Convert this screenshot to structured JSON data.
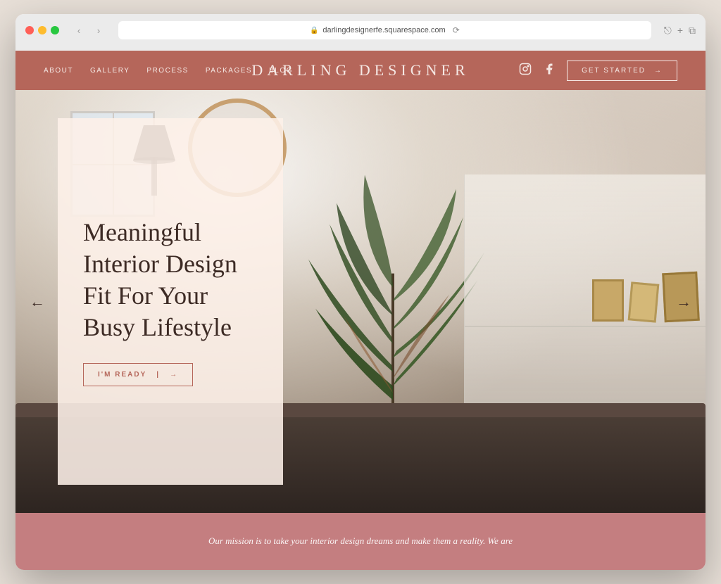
{
  "browser": {
    "url": "darlingdesignerfe.squarespace.com",
    "reload_label": "⟳"
  },
  "nav": {
    "links": [
      {
        "id": "about",
        "label": "About"
      },
      {
        "id": "gallery",
        "label": "Gallery"
      },
      {
        "id": "process",
        "label": "Process"
      },
      {
        "id": "packages",
        "label": "Packages"
      },
      {
        "id": "blog",
        "label": "Blog"
      }
    ],
    "brand": "Darling Designer",
    "cta_label": "Get Started",
    "cta_arrow": "→",
    "social": {
      "instagram": "instagram-icon",
      "facebook": "facebook-icon"
    }
  },
  "hero": {
    "title_line1": "Meaningful",
    "title_line2": "Interior Design",
    "title_line3": "Fit For Your",
    "title_line4": "Busy Lifestyle",
    "cta_label": "I'm Ready",
    "cta_arrow": "→",
    "arrow_left": "←",
    "arrow_right": "→"
  },
  "mission": {
    "text": "Our mission is to take your interior design dreams and make them a reality. We are"
  }
}
